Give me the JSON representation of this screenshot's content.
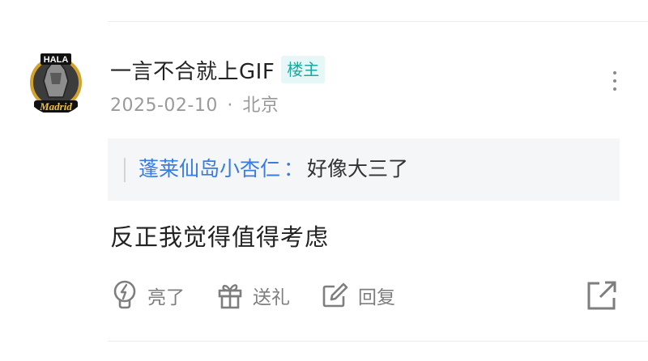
{
  "post": {
    "username": "一言不合就上GIF",
    "badge": "楼主",
    "date": "2025-02-10",
    "separator": "·",
    "location": "北京",
    "avatar_text": {
      "top": "HALA",
      "bottom": "Madrid"
    }
  },
  "quote": {
    "author": "蓬莱仙岛小杏仁",
    "separator": "：",
    "text": "好像大三了"
  },
  "content": "反正我觉得值得考虑",
  "actions": {
    "light": "亮了",
    "gift": "送礼",
    "reply": "回复"
  },
  "icons": {
    "more": "more-vertical-icon",
    "light": "lightbulb-icon",
    "gift": "gift-icon",
    "reply": "edit-icon",
    "share": "share-icon"
  },
  "colors": {
    "badge_text": "#1ca89e",
    "badge_bg": "#e5f7f6",
    "quote_author": "#3a7be0",
    "meta": "#9a9a9a"
  }
}
